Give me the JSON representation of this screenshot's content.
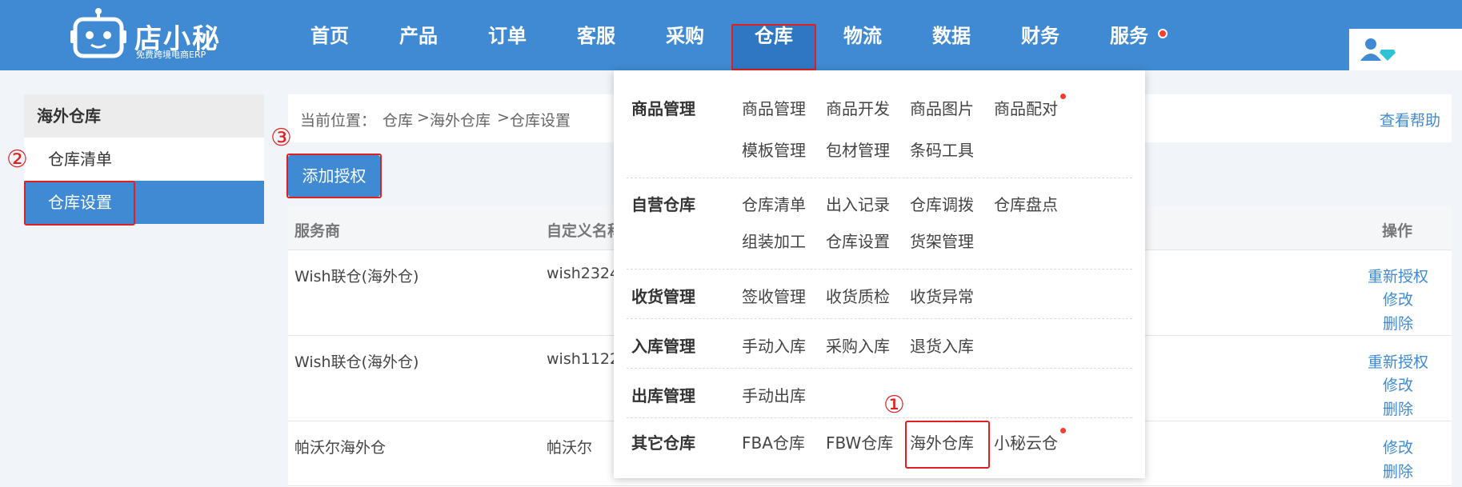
{
  "header": {
    "logo_text": "店小秘",
    "logo_subtitle": "免费跨境电商ERP",
    "nav": [
      "首页",
      "产品",
      "订单",
      "客服",
      "采购",
      "仓库",
      "物流",
      "数据",
      "财务",
      "服务"
    ],
    "active_nav": "仓库"
  },
  "sidebar": {
    "title": "海外仓库",
    "items": [
      "仓库清单",
      "仓库设置"
    ],
    "active_item": "仓库设置"
  },
  "annotations": [
    "①",
    "②",
    "③"
  ],
  "breadcrumb": {
    "prefix": "当前位置：",
    "path": [
      "仓库",
      "海外仓库",
      "仓库设置"
    ],
    "separator": ">",
    "help": "查看帮助"
  },
  "toolbar": {
    "add_label": "添加授权"
  },
  "table": {
    "columns": [
      "服务商",
      "自定义名称",
      "操作"
    ],
    "rows": [
      {
        "provider": "Wish联仓(海外仓)",
        "name": "wish2324",
        "ops": [
          "重新授权",
          "修改",
          "删除"
        ]
      },
      {
        "provider": "Wish联仓(海外仓)",
        "name": "wish1122",
        "ops": [
          "重新授权",
          "修改",
          "删除"
        ]
      },
      {
        "provider": "帕沃尔海外仓",
        "name": "帕沃尔",
        "ops": [
          "修改",
          "删除"
        ]
      }
    ]
  },
  "dropdown": {
    "sections": [
      {
        "title": "商品管理",
        "links": [
          "商品管理",
          "商品开发",
          "商品图片",
          "商品配对",
          "模板管理",
          "包材管理",
          "条码工具"
        ]
      },
      {
        "title": "自营仓库",
        "links": [
          "仓库清单",
          "出入记录",
          "仓库调拨",
          "仓库盘点",
          "组装加工",
          "仓库设置",
          "货架管理"
        ]
      },
      {
        "title": "收货管理",
        "links": [
          "签收管理",
          "收货质检",
          "收货异常"
        ]
      },
      {
        "title": "入库管理",
        "links": [
          "手动入库",
          "采购入库",
          "退货入库"
        ]
      },
      {
        "title": "出库管理",
        "links": [
          "手动出库"
        ]
      },
      {
        "title": "其它仓库",
        "links": [
          "FBA仓库",
          "FBW仓库",
          "海外仓库",
          "小秘云仓"
        ]
      }
    ],
    "highlighted": "海外仓库"
  },
  "colors": {
    "brand": "#3f8ad2",
    "highlight": "#e02020",
    "badge": "#ff3b30"
  }
}
